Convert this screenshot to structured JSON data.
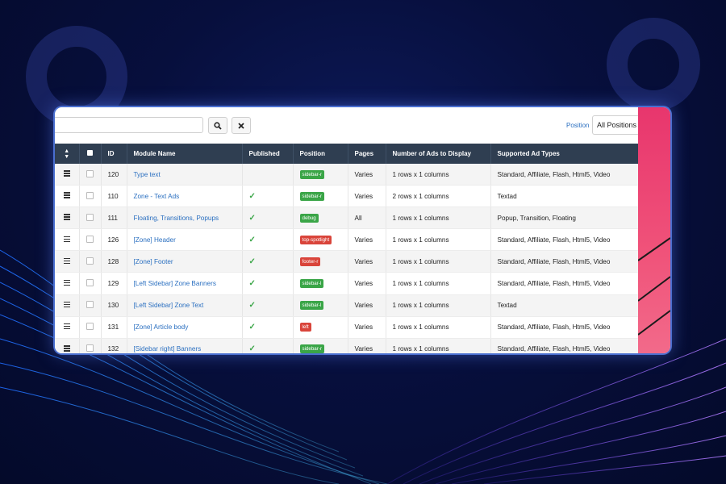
{
  "toolbar": {
    "search_value": "",
    "search_icon": "search-icon",
    "clear_icon": "close-icon",
    "position_label": "Position",
    "position_select": "All Positions"
  },
  "table": {
    "headers": [
      "",
      "",
      "ID",
      "Module Name",
      "Published",
      "Position",
      "Pages",
      "Number of Ads to Display",
      "Supported Ad Types"
    ],
    "rows": [
      {
        "id": "120",
        "name": "Type text",
        "published": false,
        "position": "sidebar-r",
        "position_color": "#3aa547",
        "pages": "Varies",
        "ads": "1 rows x 1 columns",
        "types": "Standard, Affiliate, Flash, Html5, Video"
      },
      {
        "id": "110",
        "name": "Zone - Text Ads",
        "published": true,
        "position": "sidebar-r",
        "position_color": "#3aa547",
        "pages": "Varies",
        "ads": "2 rows x 1 columns",
        "types": "Textad"
      },
      {
        "id": "111",
        "name": "Floating, Transitions, Popups",
        "published": true,
        "position": "debug",
        "position_color": "#3aa547",
        "pages": "All",
        "ads": "1 rows x 1 columns",
        "types": "Popup, Transition, Floating"
      },
      {
        "id": "126",
        "name": "[Zone] Header",
        "published": true,
        "position": "top-spotlight",
        "position_color": "#d9443a",
        "pages": "Varies",
        "ads": "1 rows x 1 columns",
        "types": "Standard, Affiliate, Flash, Html5, Video"
      },
      {
        "id": "128",
        "name": "[Zone] Footer",
        "published": true,
        "position": "footer-r",
        "position_color": "#d9443a",
        "pages": "Varies",
        "ads": "1 rows x 1 columns",
        "types": "Standard, Affiliate, Flash, Html5, Video"
      },
      {
        "id": "129",
        "name": "[Left Sidebar] Zone Banners",
        "published": true,
        "position": "sidebar-l",
        "position_color": "#3aa547",
        "pages": "Varies",
        "ads": "1 rows x 1 columns",
        "types": "Standard, Affiliate, Flash, Html5, Video"
      },
      {
        "id": "130",
        "name": "[Left Sidebar] Zone Text",
        "published": true,
        "position": "sidebar-l",
        "position_color": "#3aa547",
        "pages": "Varies",
        "ads": "1 rows x 1 columns",
        "types": "Textad"
      },
      {
        "id": "131",
        "name": "[Zone] Article body",
        "published": true,
        "position": "left",
        "position_color": "#d9443a",
        "pages": "Varies",
        "ads": "1 rows x 1 columns",
        "types": "Standard, Affiliate, Flash, Html5, Video"
      },
      {
        "id": "132",
        "name": "[Sidebar right] Banners",
        "published": true,
        "position": "sidebar-r",
        "position_color": "#3aa547",
        "pages": "Varies",
        "ads": "1 rows x 1 columns",
        "types": "Standard, Affiliate, Flash, Html5, Video"
      }
    ]
  },
  "colors": {
    "header_bg": "#2f3e51",
    "link": "#2a6fc0",
    "check": "#3aa547",
    "badge_green": "#3aa547",
    "badge_red": "#d9443a",
    "accent_pink": "#e8366d",
    "background": "#070f3d"
  }
}
